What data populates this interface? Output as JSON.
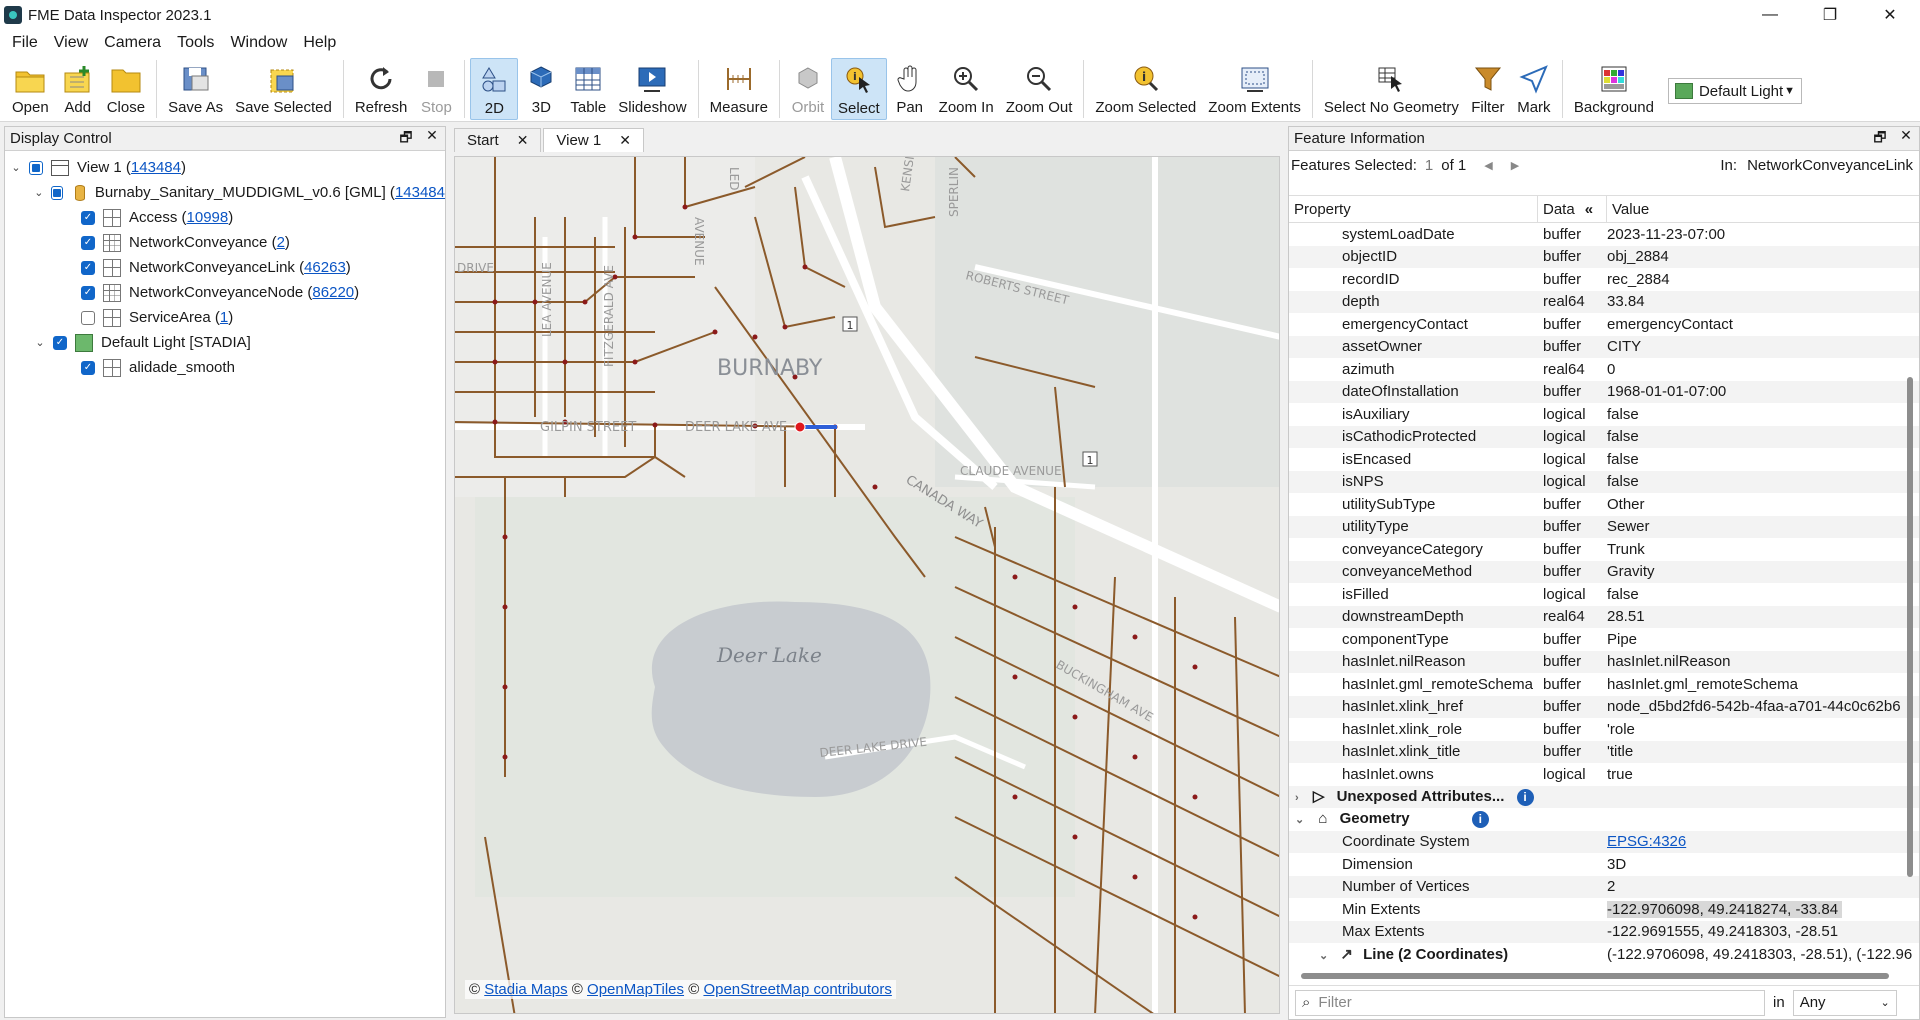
{
  "window": {
    "title": "FME Data Inspector 2023.1",
    "minimize": "—",
    "maximize": "❐",
    "close": "✕"
  },
  "menu": [
    "File",
    "View",
    "Camera",
    "Tools",
    "Window",
    "Help"
  ],
  "toolbar": {
    "open": "Open",
    "add": "Add",
    "close": "Close",
    "save_as": "Save As",
    "save_selected": "Save Selected",
    "refresh": "Refresh",
    "stop": "Stop",
    "view2d": "2D",
    "view3d": "3D",
    "table": "Table",
    "slideshow": "Slideshow",
    "measure": "Measure",
    "orbit": "Orbit",
    "select": "Select",
    "pan": "Pan",
    "zoom_in": "Zoom In",
    "zoom_out": "Zoom Out",
    "zoom_selected": "Zoom Selected",
    "zoom_extents": "Zoom Extents",
    "select_no_geometry": "Select No Geometry",
    "filter": "Filter",
    "mark": "Mark",
    "background": "Background",
    "theme": "Default Light"
  },
  "display_control": {
    "title": "Display Control",
    "view": {
      "label": "View 1 (",
      "count": "143484",
      "end": ")"
    },
    "dataset": {
      "label": "Burnaby_Sanitary_MUDDIGML_v0.6 [GML] (",
      "count": "143484"
    },
    "layers": [
      {
        "label": "Access (",
        "count": "10998",
        "end": ")",
        "checked": true
      },
      {
        "label": "NetworkConveyance (",
        "count": "2",
        "end": ")",
        "checked": true
      },
      {
        "label": "NetworkConveyanceLink (",
        "count": "46263",
        "end": ")",
        "checked": true
      },
      {
        "label": "NetworkConveyanceNode (",
        "count": "86220",
        "end": ")",
        "checked": true
      },
      {
        "label": "ServiceArea (",
        "count": "1",
        "end": ")",
        "checked": false
      }
    ],
    "basemap": {
      "label": "Default Light [STADIA]",
      "child": "alidade_smooth"
    }
  },
  "tabs": {
    "start": "Start",
    "view1": "View 1"
  },
  "map": {
    "labels": {
      "burnaby": "BURNABY",
      "deer_lake": "Deer Lake",
      "gilpin": "GILPIN STREET",
      "deer_lake_ave": "DEER LAKE AVE",
      "canada_way": "CANADA WAY",
      "roberts": "ROBERTS STREET",
      "claude": "CLAUDE AVENUE",
      "deer_lake_drive": "DEER LAKE DRIVE",
      "fitzgerald": "FITZGERALD AVE",
      "kensington": "KENSING",
      "sperling": "SPERLIN",
      "buckingham": "BUCKINGHAM AVE",
      "drive": "DRIVE",
      "ledger": "LED",
      "avenue": "AVENUE",
      "route1": "1",
      "route1b": "1",
      "lea": "LEA AVENUE"
    },
    "attribution": {
      "c1": "©",
      "stadia": "Stadia Maps",
      "c2": "©",
      "omt": "OpenMapTiles",
      "c3": "©",
      "osm": "OpenStreetMap contributors"
    }
  },
  "feature_info": {
    "title": "Feature Information",
    "features_selected_label": "Features Selected:",
    "index": "1",
    "of": "of 1",
    "in_label": "In:",
    "in_value": "NetworkConveyanceLink",
    "col_property": "Property",
    "col_data": "Data",
    "col_value": "Value",
    "rows": [
      {
        "p": "systemLoadDate",
        "d": "buffer",
        "v": "2023-11-23-07:00"
      },
      {
        "p": "objectID",
        "d": "buffer",
        "v": "obj_2884"
      },
      {
        "p": "recordID",
        "d": "buffer",
        "v": "rec_2884"
      },
      {
        "p": "depth",
        "d": "real64",
        "v": "33.84"
      },
      {
        "p": "emergencyContact",
        "d": "buffer",
        "v": "emergencyContact"
      },
      {
        "p": "assetOwner",
        "d": "buffer",
        "v": "CITY"
      },
      {
        "p": "azimuth",
        "d": "real64",
        "v": "0"
      },
      {
        "p": "dateOfInstallation",
        "d": "buffer",
        "v": "1968-01-01-07:00"
      },
      {
        "p": "isAuxiliary",
        "d": "logical",
        "v": "false"
      },
      {
        "p": "isCathodicProtected",
        "d": "logical",
        "v": "false"
      },
      {
        "p": "isEncased",
        "d": "logical",
        "v": "false"
      },
      {
        "p": "isNPS",
        "d": "logical",
        "v": "false"
      },
      {
        "p": "utilitySubType",
        "d": "buffer",
        "v": "Other"
      },
      {
        "p": "utilityType",
        "d": "buffer",
        "v": "Sewer"
      },
      {
        "p": "conveyanceCategory",
        "d": "buffer",
        "v": "Trunk"
      },
      {
        "p": "conveyanceMethod",
        "d": "buffer",
        "v": "Gravity"
      },
      {
        "p": "isFilled",
        "d": "logical",
        "v": "false"
      },
      {
        "p": "downstreamDepth",
        "d": "real64",
        "v": "28.51"
      },
      {
        "p": "componentType",
        "d": "buffer",
        "v": "Pipe"
      },
      {
        "p": "hasInlet.nilReason",
        "d": "buffer",
        "v": "hasInlet.nilReason"
      },
      {
        "p": "hasInlet.gml_remoteSchema",
        "d": "buffer",
        "v": "hasInlet.gml_remoteSchema"
      },
      {
        "p": "hasInlet.xlink_href",
        "d": "buffer",
        "v": "node_d5bd2fd6-542b-4faa-a701-44c0c62b6"
      },
      {
        "p": "hasInlet.xlink_role",
        "d": "buffer",
        "v": "'role"
      },
      {
        "p": "hasInlet.xlink_title",
        "d": "buffer",
        "v": "'title"
      },
      {
        "p": "hasInlet.owns",
        "d": "logical",
        "v": "true"
      }
    ],
    "unexposed": "Unexposed Attributes...",
    "geometry": "Geometry",
    "geom_rows": [
      {
        "p": "Coordinate System",
        "v": "EPSG:4326"
      },
      {
        "p": "Dimension",
        "v": "3D"
      },
      {
        "p": "Number of Vertices",
        "v": "2"
      },
      {
        "p": "Min Extents",
        "v": "-122.9706098, 49.2418274, -33.84"
      },
      {
        "p": "Max Extents",
        "v": "-122.9691555, 49.2418303, -28.51"
      }
    ],
    "line": {
      "p": "Line (2 Coordinates)",
      "v": "(-122.9706098, 49.2418303, -28.51), (-122.96"
    },
    "filter_placeholder": "Filter",
    "in_word": "in",
    "filter_scope": "Any"
  }
}
